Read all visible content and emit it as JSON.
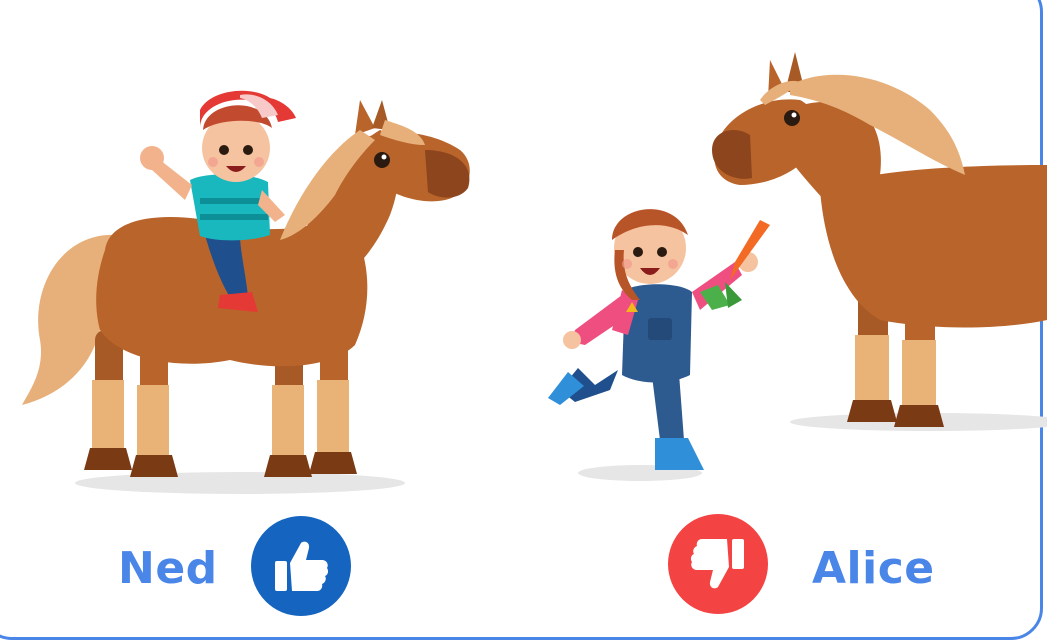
{
  "people": [
    {
      "name": "Ned",
      "vote": "thumbs-up"
    },
    {
      "name": "Alice",
      "vote": "thumbs-down"
    }
  ],
  "colors": {
    "label": "#4a86e8",
    "frame": "#4a86e8",
    "thumbs_up_badge": "#1565c0",
    "thumbs_down_badge": "#f44343",
    "horse_body": "#b8642a",
    "horse_mane": "#e7b07a"
  }
}
